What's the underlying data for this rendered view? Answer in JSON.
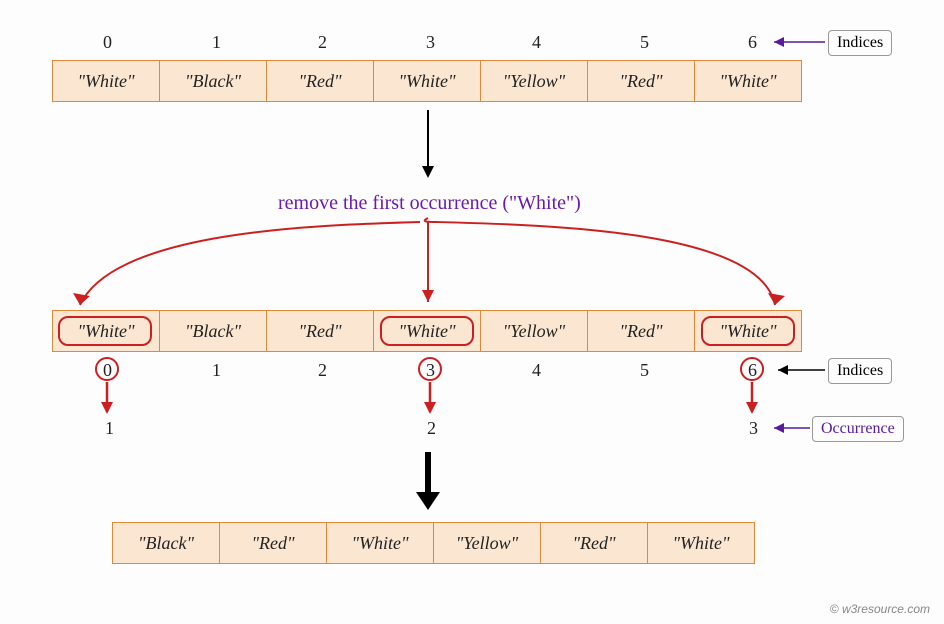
{
  "indices_top": [
    "0",
    "1",
    "2",
    "3",
    "4",
    "5",
    "6"
  ],
  "array1": [
    "\"White\"",
    "\"Black\"",
    "\"Red\"",
    "\"White\"",
    "\"Yellow\"",
    "\"Red\"",
    "\"White\""
  ],
  "caption": "remove the first occurrence (\"White\")",
  "array2": [
    "\"White\"",
    "\"Black\"",
    "\"Red\"",
    "\"White\"",
    "\"Yellow\"",
    "\"Red\"",
    "\"White\""
  ],
  "indices_mid": [
    "0",
    "1",
    "2",
    "3",
    "4",
    "5",
    "6"
  ],
  "occurrence": [
    "1",
    "2",
    "3"
  ],
  "array3": [
    "\"Black\"",
    "\"Red\"",
    "\"White\"",
    "\"Yellow\"",
    "\"Red\"",
    "\"White\""
  ],
  "labels": {
    "indices": "Indices",
    "occurrence": "Occurrence"
  },
  "credit": "© w3resource.com"
}
